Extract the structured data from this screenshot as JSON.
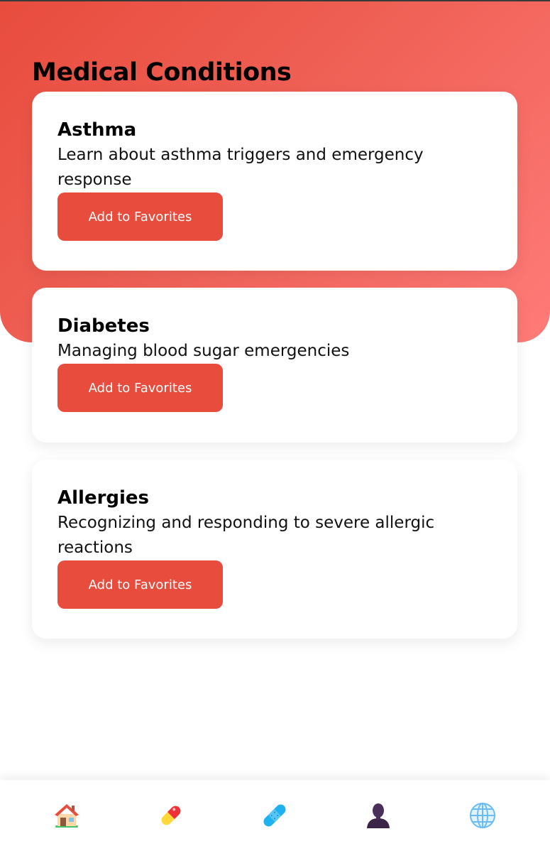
{
  "page": {
    "title": "Medical Conditions"
  },
  "conditions": [
    {
      "title": "Asthma",
      "description": "Learn about asthma triggers and emergency response",
      "button_label": "Add to Favorites"
    },
    {
      "title": "Diabetes",
      "description": "Managing blood sugar emergencies",
      "button_label": "Add to Favorites"
    },
    {
      "title": "Allergies",
      "description": "Recognizing and responding to severe allergic reactions",
      "button_label": "Add to Favorites"
    }
  ],
  "bottom_nav": {
    "items": [
      {
        "icon": "home-icon"
      },
      {
        "icon": "pill-icon"
      },
      {
        "icon": "bandage-icon"
      },
      {
        "icon": "person-icon"
      },
      {
        "icon": "globe-icon"
      }
    ]
  },
  "colors": {
    "accent": "#e84c3d",
    "header_gradient_start": "#e84c3d",
    "header_gradient_end": "#ff7b78",
    "card_bg": "#ffffff"
  }
}
